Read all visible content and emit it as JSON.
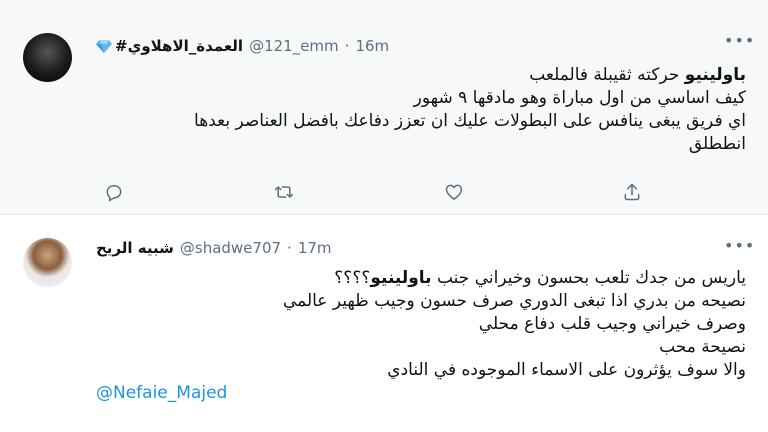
{
  "tweets": [
    {
      "display_name": "#العمدة_الاهلاوي",
      "handle": "@121_emm",
      "separator": "·",
      "time": "16m",
      "more_label": "•••",
      "lines": [
        {
          "bold": "باولينيو",
          "text": " حركته ثقيبلة فالملعب"
        },
        {
          "bold": "",
          "text": "كيف اساسي من اول مباراة وهو مادقها ٩ شهور"
        },
        {
          "bold": "",
          "text": "اي فريق يبغى ينافس على البطولات عليك ان تعزز دفاعك بافضل العناصر بعدها"
        },
        {
          "bold": "",
          "text": "انططلق"
        }
      ],
      "actions": [
        "reply-icon",
        "retweet-icon",
        "like-icon",
        "share-icon"
      ]
    },
    {
      "display_name": "شبيه الريح",
      "handle": "@shadwe707",
      "separator": "·",
      "time": "17m",
      "more_label": "•••",
      "lines": [
        {
          "pre": "ياريس من جدك تلعب بحسون وخيراني جنب ",
          "bold": "باولينيو",
          "post": "؟؟؟؟"
        },
        {
          "text": "نصيحه من بدري اذا تبغى الدوري صرف حسون وجيب ظهير عالمي"
        },
        {
          "text": "وصرف خيراني وجيب قلب دفاع محلي"
        },
        {
          "text": "نصيحة محب"
        },
        {
          "text": "والا سوف يؤثرون على الاسماء الموجوده في النادي"
        }
      ],
      "mention": "@Nefaie_Majed"
    }
  ],
  "colors": {
    "link": "#1b95e0",
    "muted": "#5b7083",
    "hover_bg": "#f7f9f9",
    "divider": "#e6ecf0"
  }
}
